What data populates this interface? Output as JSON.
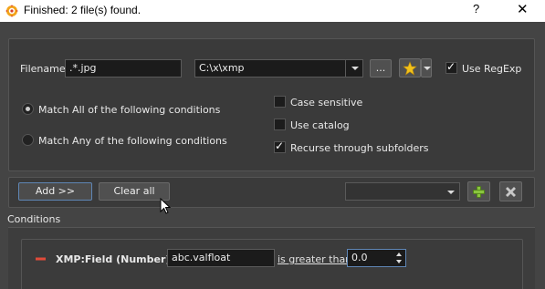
{
  "window": {
    "title": "Finished: 2 file(s) found.",
    "help_label": "?",
    "close_label": "✕"
  },
  "search": {
    "filename_label": "Filename",
    "filename_value": ".*.jpg",
    "folder_value": "C:\\x\\xmp",
    "browse_label": "...",
    "use_regexp_label": "Use RegExp",
    "use_regexp_checked": true
  },
  "match": {
    "all_label": "Match All of the following conditions",
    "any_label": "Match Any of the following conditions",
    "selected": "all"
  },
  "options": {
    "case_sensitive_label": "Case sensitive",
    "case_sensitive_checked": false,
    "use_catalog_label": "Use catalog",
    "use_catalog_checked": false,
    "recurse_label": "Recurse through subfolders",
    "recurse_checked": true
  },
  "buttons": {
    "add_label": "Add >>",
    "clear_label": "Clear all",
    "condition_select_value": ""
  },
  "conditions": {
    "heading": "Conditions",
    "rows": [
      {
        "remove_label": "−",
        "field": "XMP:Field (Number)",
        "value": "abc.valfloat",
        "operator": "is greater than",
        "operand": "0.0"
      }
    ]
  },
  "colors": {
    "background": "#444444",
    "panel": "#3a3a3a",
    "accent_add": "#8ac53f",
    "remove_red": "#e04b3a",
    "star": "#f2c21b"
  },
  "icons": [
    "app-icon",
    "star-icon",
    "plus-icon",
    "delete-icon",
    "minus-icon",
    "chevron-down-icon"
  ]
}
